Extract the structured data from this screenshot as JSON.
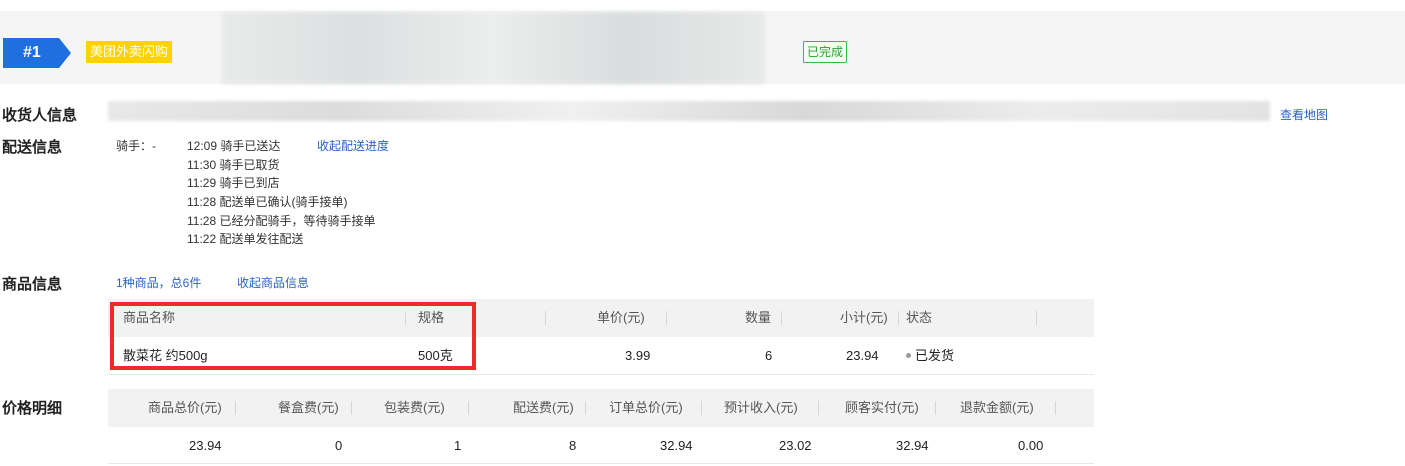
{
  "order": {
    "number": "#1",
    "platform": "美团外卖闪购",
    "status": "已完成"
  },
  "consignee": {
    "label": "收货人信息",
    "map_link": "查看地图"
  },
  "delivery": {
    "label": "配送信息",
    "rider": "骑手：-",
    "toggle": "收起配送进度",
    "events": [
      {
        "text": "12:09 骑手已送达"
      },
      {
        "text": "11:30 骑手已取货"
      },
      {
        "text": "11:29 骑手已到店"
      },
      {
        "text": "11:28 配送单已确认(骑手接单)"
      },
      {
        "text": "11:28 已经分配骑手，等待骑手接单"
      },
      {
        "text": "11:22 配送单发往配送"
      }
    ]
  },
  "goods": {
    "label": "商品信息",
    "summary": "1种商品，总6件",
    "toggle": "收起商品信息",
    "columns": {
      "name": "商品名称",
      "spec": "规格",
      "unit_price": "单价(元)",
      "qty": "数量",
      "subtotal": "小计(元)",
      "status": "状态"
    },
    "rows": [
      {
        "name": "散菜花 约500g",
        "spec": "500克",
        "unit_price": "3.99",
        "qty": "6",
        "subtotal": "23.94",
        "status": "已发货"
      }
    ]
  },
  "price": {
    "label": "价格明细",
    "columns": {
      "goods_total": "商品总价(元)",
      "box_fee": "餐盒费(元)",
      "pack_fee": "包装费(元)",
      "delivery_fee": "配送费(元)",
      "order_total": "订单总价(元)",
      "est_income": "预计收入(元)",
      "customer_paid": "顾客实付(元)",
      "refund": "退款金额(元)"
    },
    "values": {
      "goods_total": "23.94",
      "box_fee": "0",
      "pack_fee": "1",
      "delivery_fee": "8",
      "order_total": "32.94",
      "est_income": "23.02",
      "customer_paid": "32.94",
      "refund": "0.00"
    }
  },
  "colors": {
    "badge_blue": "#1f6fe0",
    "platform_yellow": "#ffd200",
    "status_green": "#3aba3a",
    "link_blue": "#2a62c9",
    "highlight_red": "#ee2a2a"
  }
}
